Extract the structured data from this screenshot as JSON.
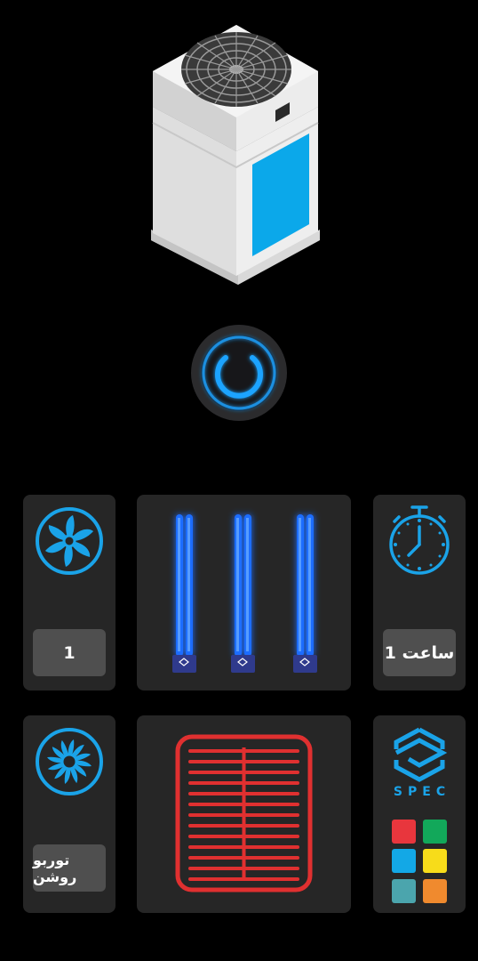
{
  "fan_speed": {
    "value": "1"
  },
  "timer": {
    "value": "1 ساعت"
  },
  "turbo": {
    "label": "توربو روشن"
  },
  "brand": {
    "name": "SPEC",
    "lamp_label": "SPEC"
  },
  "colors": {
    "accent_blue": "#1aa3e8",
    "uv_blue": "#1e6dff",
    "heater_red": "#e03030",
    "card": "#262626",
    "pill": "#4f4f4f"
  },
  "color_swatches": [
    "#e8363d",
    "#12a85a",
    "#13a8e6",
    "#f7dc1a",
    "#4ba5ad",
    "#f08a2e"
  ],
  "icons": [
    "purifier-device-icon",
    "power-icon",
    "fan-icon",
    "stopwatch-icon",
    "turbo-fan-icon",
    "spec-logo-icon",
    "heater-grid-icon",
    "uv-lamp-icon"
  ]
}
